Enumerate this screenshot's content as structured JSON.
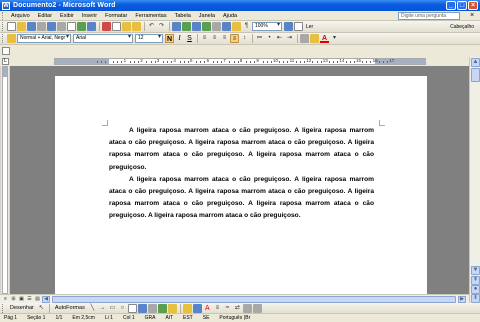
{
  "window": {
    "title": "Documento2 - Microsoft Word",
    "app_icon": "W"
  },
  "menu": {
    "items": [
      "Arquivo",
      "Editar",
      "Exibir",
      "Inserir",
      "Formatar",
      "Ferramentas",
      "Tabela",
      "Janela",
      "Ajuda"
    ],
    "help_placeholder": "Digite uma pergunta"
  },
  "standard_toolbar": {
    "zoom": "100%",
    "read_label": "Ler",
    "extra_label": "Cabeçalho"
  },
  "formatting_toolbar": {
    "style": "Normal + Arial, Negr",
    "font": "Arial",
    "size": "12",
    "bold": "N",
    "italic": "I",
    "underline": "S",
    "font_color_letter": "A"
  },
  "ruler": {
    "numbers": [
      "1",
      "2",
      "3",
      "4",
      "5",
      "6",
      "7",
      "8",
      "9",
      "10",
      "11",
      "12",
      "13",
      "14",
      "15",
      "16",
      "17"
    ]
  },
  "document": {
    "paragraphs": [
      "A ligeira raposa marrom ataca o cão preguiçoso.  A ligeira raposa marrom ataca o cão preguiçoso.  A ligeira raposa marrom ataca o cão preguiçoso.  A ligeira raposa marrom ataca o cão preguiçoso.  A ligeira raposa marrom ataca o cão preguiçoso.",
      "A ligeira raposa marrom ataca o cão preguiçoso.  A ligeira raposa marrom ataca o cão preguiçoso.  A ligeira raposa marrom ataca o cão preguiçoso.  A ligeira raposa marrom ataca o cão preguiçoso.  A ligeira raposa marrom ataca o cão preguiçoso.  A ligeira raposa marrom ataca o cão preguiçoso."
    ]
  },
  "drawing_toolbar": {
    "draw_label": "Desenhar",
    "autoshapes_label": "AutoFormas"
  },
  "status": {
    "items": [
      "Pág 1",
      "Seção 1",
      "1/1",
      "Em 2,5cm",
      "Li 1",
      "Col 1",
      "GRA",
      "AlT",
      "EST",
      "SE",
      "Português (Br"
    ]
  },
  "colors": {
    "titlebar": "#0a5ee0",
    "chrome": "#ece9d8",
    "page": "#ffffff",
    "workspace": "#808080"
  }
}
